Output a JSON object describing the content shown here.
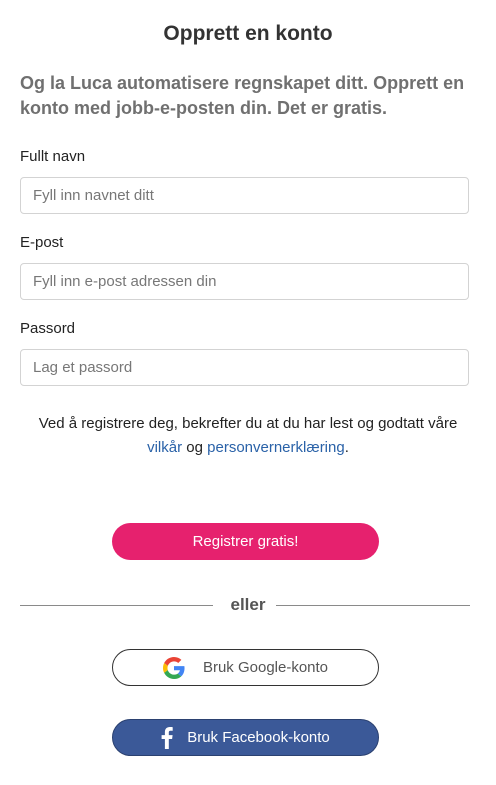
{
  "form": {
    "title": "Opprett en konto",
    "subtitle": "Og la Luca automatisere regnskapet ditt. Opprett en konto med jobb-e-posten din. Det er gratis.",
    "fields": [
      {
        "label": "Fullt navn",
        "placeholder": "Fyll inn navnet ditt",
        "value": ""
      },
      {
        "label": "E-post",
        "placeholder": "Fyll inn e-post adressen din",
        "value": ""
      },
      {
        "label": "Passord",
        "placeholder": "Lag et passord",
        "value": ""
      }
    ],
    "terms": {
      "prefix": "Ved å registrere deg, bekrefter du at du har lest og godtatt våre",
      "terms_link": "vilkår",
      "connector": "og",
      "privacy_link": "personvernerklæring",
      "suffix": "."
    },
    "submit_label": "Registrer gratis!",
    "divider_text": "eller",
    "google_label": "Bruk Google-konto",
    "facebook_label": "Bruk Facebook-konto"
  },
  "icons": {
    "google": "google-g-icon",
    "facebook": "facebook-f-icon"
  },
  "colors": {
    "primary_button": "#e6216e",
    "facebook_button": "#3b5998",
    "link": "#2a62a8",
    "subtitle": "#707070"
  }
}
